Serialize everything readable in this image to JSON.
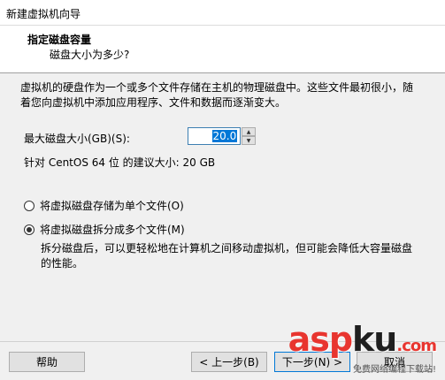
{
  "window": {
    "title": "新建虚拟机向导"
  },
  "header": {
    "title": "指定磁盘容量",
    "subtitle": "磁盘大小为多少?"
  },
  "body": {
    "description": "虚拟机的硬盘作为一个或多个文件存储在主机的物理磁盘中。这些文件最初很小，随着您向虚拟机中添加应用程序、文件和数据而逐渐变大。",
    "max_size_label": "最大磁盘大小(GB)(S):",
    "max_size_value": "20.0",
    "recommended_text": "针对 CentOS 64 位 的建议大小: 20 GB",
    "radio_single_label": "将虚拟磁盘存储为单个文件(O)",
    "radio_multi_label": "将虚拟磁盘拆分成多个文件(M)",
    "selected_option": "multi",
    "split_description": "拆分磁盘后，可以更轻松地在计算机之间移动虚拟机，但可能会降低大容量磁盘的性能。"
  },
  "footer": {
    "help_label": "帮助",
    "back_label": "< 上一步(B)",
    "next_label": "下一步(N) >",
    "cancel_label": "取消"
  },
  "watermark": {
    "logo_a": "asp",
    "logo_b": "ku",
    "logo_c": ".com",
    "sub": "免费网络编程下载站!"
  },
  "colors": {
    "accent": "#0078d7",
    "logo_red": "#e8352f"
  }
}
